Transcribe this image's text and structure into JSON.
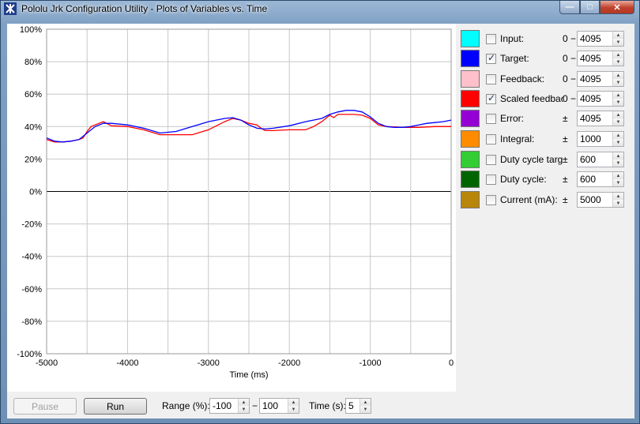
{
  "window": {
    "title": "Pololu Jrk Configuration Utility - Plots of Variables vs. Time",
    "min_glyph": "—",
    "max_glyph": "□",
    "close_glyph": "✕"
  },
  "plot": {
    "y_ticks": [
      "100%",
      "80%",
      "60%",
      "40%",
      "20%",
      "0%",
      "-20%",
      "-40%",
      "-60%",
      "-80%",
      "-100%"
    ],
    "x_ticks": [
      "-5000",
      "-4000",
      "-3000",
      "-2000",
      "-1000",
      "0"
    ],
    "x_label": "Time (ms)",
    "colors": {
      "target": "#0000ff",
      "scaled_feedback": "#ff0000",
      "grid": "#c8c8c8",
      "zero_line": "#000000"
    }
  },
  "chart_data": {
    "type": "line",
    "xlabel": "Time (ms)",
    "ylabel": "",
    "xlim": [
      -5000,
      0
    ],
    "ylim": [
      -100,
      100
    ],
    "grid": true,
    "series": [
      {
        "name": "Target",
        "color": "#0000ff",
        "x": [
          -5000,
          -4900,
          -4800,
          -4700,
          -4600,
          -4500,
          -4400,
          -4300,
          -4200,
          -4000,
          -3800,
          -3600,
          -3400,
          -3200,
          -3000,
          -2800,
          -2700,
          -2600,
          -2500,
          -2400,
          -2300,
          -2200,
          -2000,
          -1800,
          -1600,
          -1500,
          -1400,
          -1300,
          -1200,
          -1100,
          -1000,
          -900,
          -800,
          -700,
          -600,
          -500,
          -400,
          -300,
          -200,
          -100,
          0
        ],
        "y": [
          33,
          31,
          30.5,
          31,
          32,
          36,
          40,
          42,
          42,
          41,
          39,
          36,
          37,
          40,
          43,
          45,
          45.5,
          44,
          41,
          39,
          38.5,
          39,
          40.5,
          43,
          45,
          47.5,
          49,
          50,
          50,
          49,
          46,
          42,
          40,
          39.5,
          39.5,
          40,
          41,
          42,
          42.5,
          43,
          44
        ]
      },
      {
        "name": "Scaled feedback",
        "color": "#ff0000",
        "x": [
          -5000,
          -4900,
          -4800,
          -4700,
          -4600,
          -4550,
          -4500,
          -4450,
          -4400,
          -4300,
          -4200,
          -4000,
          -3800,
          -3600,
          -3400,
          -3200,
          -3000,
          -2800,
          -2700,
          -2600,
          -2500,
          -2400,
          -2350,
          -2300,
          -2200,
          -2000,
          -1800,
          -1700,
          -1600,
          -1500,
          -1450,
          -1400,
          -1300,
          -1200,
          -1100,
          -1000,
          -900,
          -800,
          -600,
          -400,
          -200,
          0
        ],
        "y": [
          32,
          30.5,
          30.5,
          31,
          32,
          33,
          37,
          40,
          41,
          43,
          40.5,
          40,
          38,
          35,
          35,
          35,
          38,
          43,
          45,
          44,
          42,
          41,
          39,
          37.5,
          37.5,
          38,
          38,
          40,
          43,
          47,
          45.5,
          47.5,
          47.5,
          47.5,
          47,
          45,
          41,
          40,
          39.5,
          39.5,
          40,
          40
        ]
      }
    ]
  },
  "legend": [
    {
      "label": "Input:",
      "color": "#00ffff",
      "checked": false,
      "prefix": "0 −",
      "value": "4095"
    },
    {
      "label": "Target:",
      "color": "#0000ff",
      "checked": true,
      "prefix": "0 −",
      "value": "4095"
    },
    {
      "label": "Feedback:",
      "color": "#ffc0cb",
      "checked": false,
      "prefix": "0 −",
      "value": "4095"
    },
    {
      "label": "Scaled feedback:",
      "color": "#ff0000",
      "checked": true,
      "prefix": "0 −",
      "value": "4095"
    },
    {
      "label": "Error:",
      "color": "#9400d3",
      "checked": false,
      "prefix": "±",
      "value": "4095"
    },
    {
      "label": "Integral:",
      "color": "#ff8c00",
      "checked": false,
      "prefix": "±",
      "value": "1000"
    },
    {
      "label": "Duty cycle target:",
      "color": "#32cd32",
      "checked": false,
      "prefix": "±",
      "value": "600"
    },
    {
      "label": "Duty cycle:",
      "color": "#006400",
      "checked": false,
      "prefix": "±",
      "value": "600"
    },
    {
      "label": "Current (mA):",
      "color": "#b8860b",
      "checked": false,
      "prefix": "±",
      "value": "5000"
    }
  ],
  "controls": {
    "pause_label": "Pause",
    "run_label": "Run",
    "range_label": "Range (%):",
    "range_min": "-100",
    "range_dash": "−",
    "range_max": "100",
    "time_label": "Time (s):",
    "time_value": "5"
  }
}
